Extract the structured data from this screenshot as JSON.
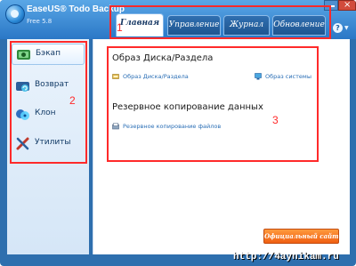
{
  "app": {
    "title": "EaseUS® Todo Backup",
    "version": "Free 5.8"
  },
  "window_controls": {
    "close_glyph": "×"
  },
  "tabs": [
    {
      "label": "Главная",
      "active": true
    },
    {
      "label": "Управление",
      "active": false
    },
    {
      "label": "Журнал",
      "active": false
    },
    {
      "label": "Обновление",
      "active": false
    }
  ],
  "help": {
    "glyph": "?",
    "caret": "▼"
  },
  "annotations": {
    "tabs_number": "1",
    "sidebar_number": "2",
    "main_number": "3"
  },
  "sidebar": {
    "items": [
      {
        "label": "Бэкап",
        "icon": "backup-icon",
        "active": true
      },
      {
        "label": "Возврат",
        "icon": "restore-icon",
        "active": false
      },
      {
        "label": "Клон",
        "icon": "clone-icon",
        "active": false
      },
      {
        "label": "Утилиты",
        "icon": "tools-icon",
        "active": false
      }
    ]
  },
  "main": {
    "section1_title": "Образ Диска/Раздела",
    "disk_image_link": "Образ Диска/Раздела",
    "system_image_link": "Образ системы",
    "section2_title": "Резервное копирование данных",
    "file_backup_link": "Резервное копирование файлов"
  },
  "footer": {
    "official_site_button": "Официальный сайт"
  },
  "watermark": "http://4aynikam.ru",
  "colors": {
    "accent": "#2a77c6",
    "annotation_red": "#ff2a2a",
    "official_orange": "#f05f12",
    "link_blue": "#2b6fb6"
  }
}
